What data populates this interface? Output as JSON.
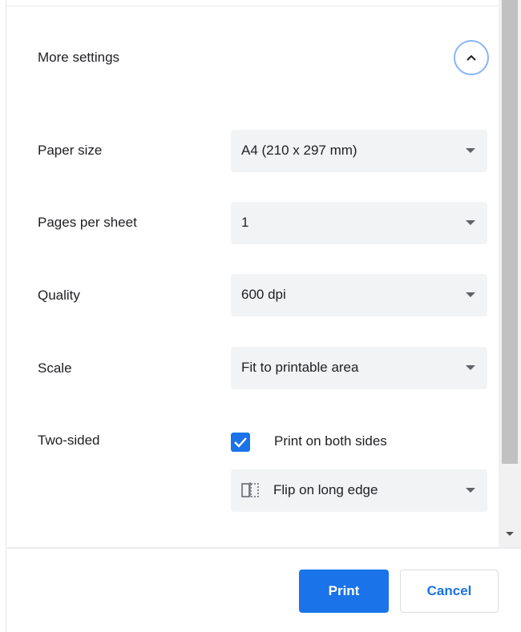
{
  "more_settings": {
    "label": "More settings",
    "toggle_icon": "chevron-up-icon",
    "expanded": true
  },
  "settings": {
    "paper_size": {
      "label": "Paper size",
      "value": "A4 (210 x 297 mm)"
    },
    "pages_per_sheet": {
      "label": "Pages per sheet",
      "value": "1"
    },
    "quality": {
      "label": "Quality",
      "value": "600 dpi"
    },
    "scale": {
      "label": "Scale",
      "value": "Fit to printable area"
    },
    "two_sided": {
      "label": "Two-sided",
      "checkbox_label": "Print on both sides",
      "checked": true,
      "flip_value": "Flip on long edge",
      "flip_icon": "flip-long-edge-icon"
    }
  },
  "footer": {
    "print_label": "Print",
    "cancel_label": "Cancel"
  },
  "colors": {
    "accent": "#1a73e8",
    "select_bg": "#f1f3f4",
    "focus_ring": "#8ab4f8"
  }
}
